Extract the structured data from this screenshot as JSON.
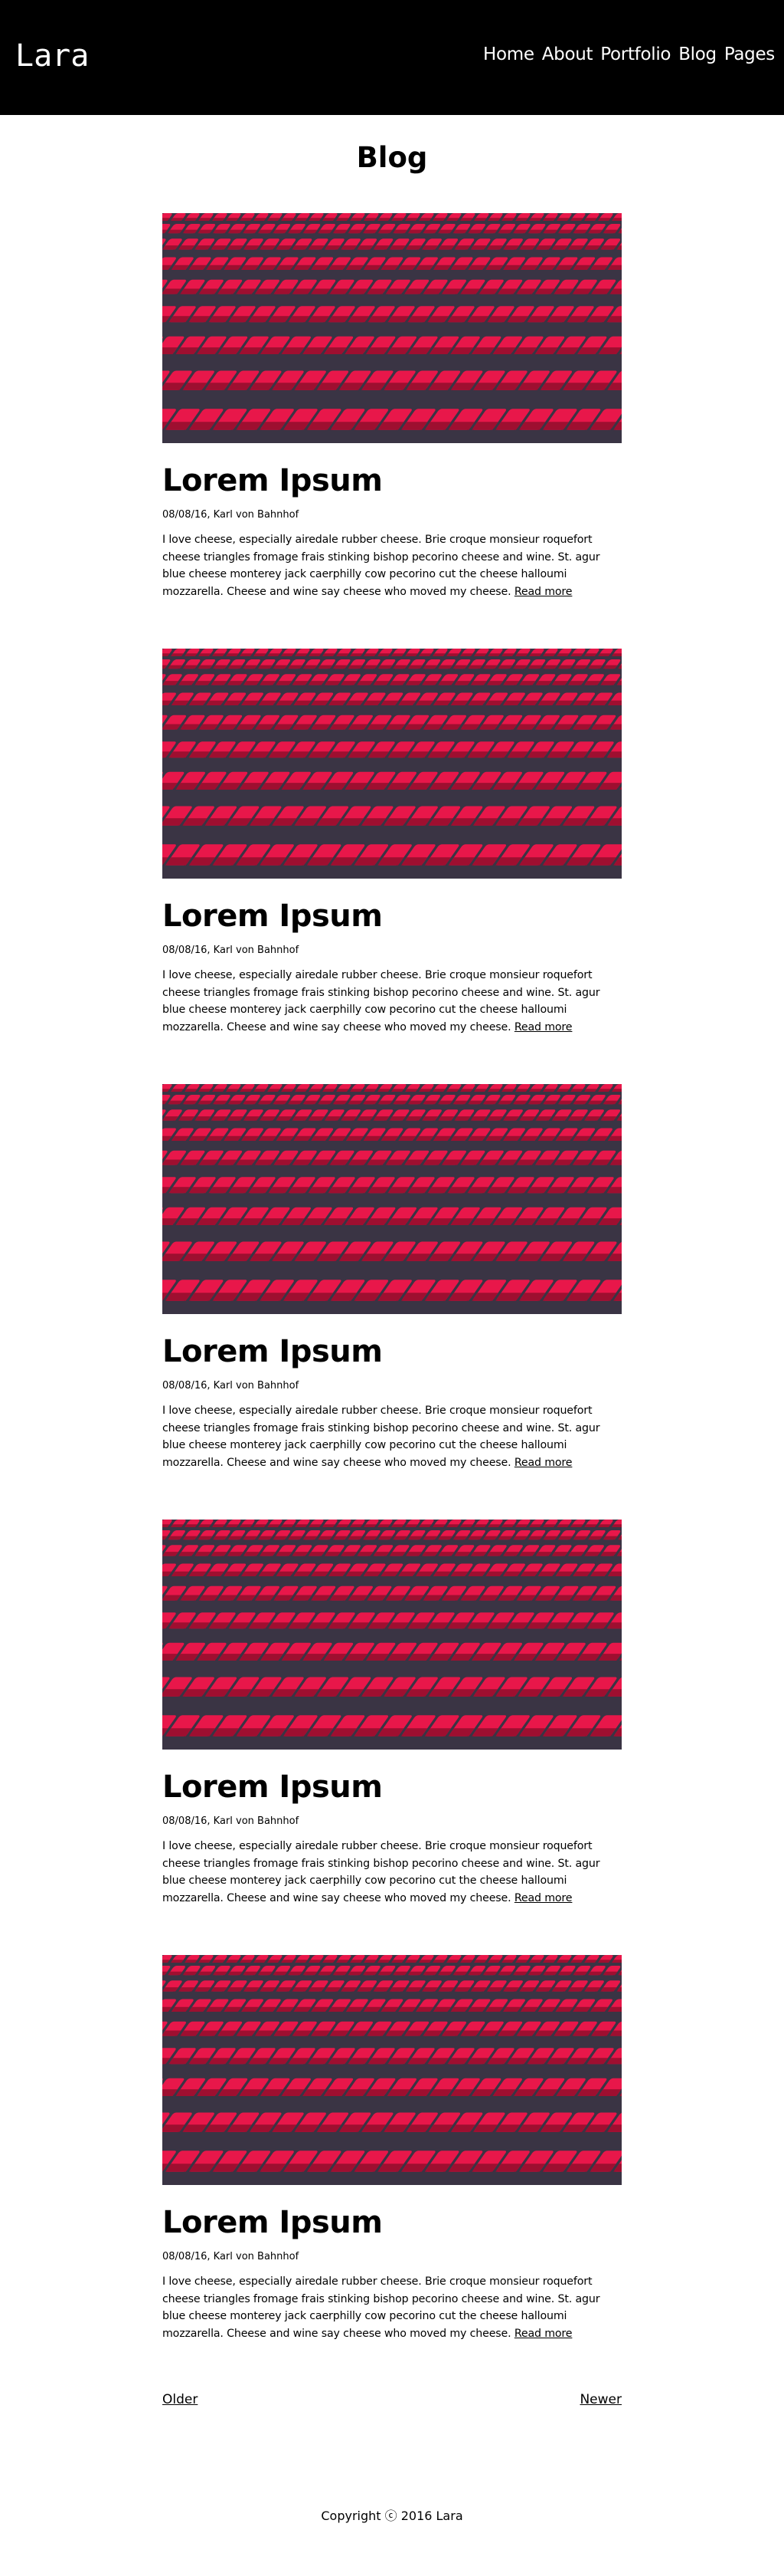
{
  "header": {
    "logo": "Lara",
    "nav": [
      "Home",
      "About",
      "Portfolio",
      "Blog",
      "Pages"
    ]
  },
  "page": {
    "title": "Blog"
  },
  "posts": [
    {
      "image": "red-stadium-seats-image",
      "title": "Lorem Ipsum",
      "meta": "08/08/16, Karl von Bahnhof",
      "excerpt": "I love cheese, especially airedale rubber cheese. Brie croque monsieur roquefort cheese triangles fromage frais stinking bishop pecorino cheese and wine. St. agur blue cheese monterey jack caerphilly cow pecorino cut the cheese halloumi mozzarella. Cheese and wine say cheese who moved my cheese.",
      "read_more": "Read more"
    },
    {
      "image": "red-stadium-seats-image",
      "title": "Lorem Ipsum",
      "meta": "08/08/16, Karl von Bahnhof",
      "excerpt": "I love cheese, especially airedale rubber cheese. Brie croque monsieur roquefort cheese triangles fromage frais stinking bishop pecorino cheese and wine. St. agur blue cheese monterey jack caerphilly cow pecorino cut the cheese halloumi mozzarella. Cheese and wine say cheese who moved my cheese.",
      "read_more": "Read more"
    },
    {
      "image": "red-stadium-seats-image",
      "title": "Lorem Ipsum",
      "meta": "08/08/16, Karl von Bahnhof",
      "excerpt": "I love cheese, especially airedale rubber cheese. Brie croque monsieur roquefort cheese triangles fromage frais stinking bishop pecorino cheese and wine. St. agur blue cheese monterey jack caerphilly cow pecorino cut the cheese halloumi mozzarella. Cheese and wine say cheese who moved my cheese.",
      "read_more": "Read more"
    },
    {
      "image": "red-stadium-seats-image",
      "title": "Lorem Ipsum",
      "meta": "08/08/16, Karl von Bahnhof",
      "excerpt": "I love cheese, especially airedale rubber cheese. Brie croque monsieur roquefort cheese triangles fromage frais stinking bishop pecorino cheese and wine. St. agur blue cheese monterey jack caerphilly cow pecorino cut the cheese halloumi mozzarella. Cheese and wine say cheese who moved my cheese.",
      "read_more": "Read more"
    },
    {
      "image": "red-stadium-seats-image",
      "title": "Lorem Ipsum",
      "meta": "08/08/16, Karl von Bahnhof",
      "excerpt": "I love cheese, especially airedale rubber cheese. Brie croque monsieur roquefort cheese triangles fromage frais stinking bishop pecorino cheese and wine. St. agur blue cheese monterey jack caerphilly cow pecorino cut the cheese halloumi mozzarella. Cheese and wine say cheese who moved my cheese.",
      "read_more": "Read more"
    }
  ],
  "pagination": {
    "older": "Older",
    "newer": "Newer"
  },
  "footer": {
    "copyright": "Copyright ⓒ 2016 Lara"
  },
  "colors": {
    "header_bg": "#000000",
    "header_text": "#ffffff",
    "seat_red": "#e8174a",
    "seat_dark": "#9e0f30",
    "seat_shadow": "#3a3444"
  }
}
